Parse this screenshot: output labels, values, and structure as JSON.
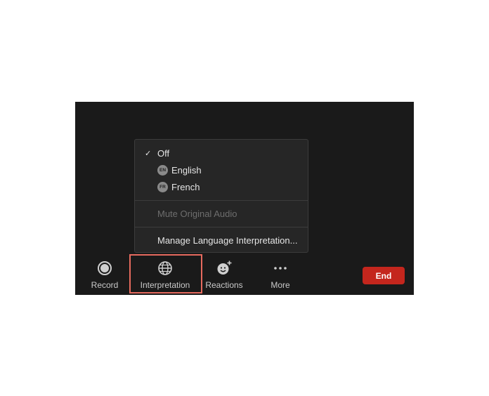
{
  "interpretation_menu": {
    "items": [
      {
        "label": "Off",
        "checked": true
      },
      {
        "label": "English",
        "badge": "EN"
      },
      {
        "label": "French",
        "badge": "FR"
      }
    ],
    "mute_original_audio": "Mute Original Audio",
    "manage_language_interpretation": "Manage Language Interpretation..."
  },
  "toolbar": {
    "record_label": "Record",
    "interpretation_label": "Interpretation",
    "reactions_label": "Reactions",
    "more_label": "More",
    "end_label": "End"
  },
  "icons": {
    "record": "record-icon",
    "interpretation": "globe-icon",
    "reactions": "smiley-plus-icon",
    "more": "ellipsis-icon",
    "check": "checkmark-icon"
  },
  "colors": {
    "meeting_background": "#1a1a1a",
    "menu_background": "#262626",
    "end_button": "#c4261d",
    "highlight_outline": "#e66a5e"
  }
}
